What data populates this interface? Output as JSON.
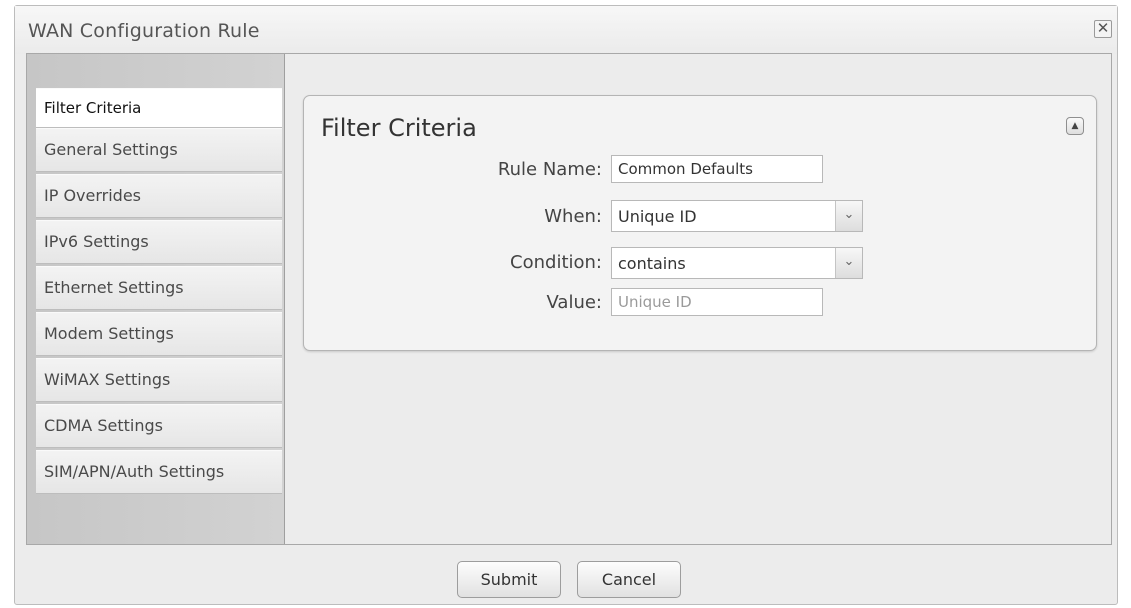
{
  "dialog": {
    "title": "WAN Configuration Rule",
    "close_icon": "close-icon",
    "close_glyph": "✕"
  },
  "sidebar": {
    "items": [
      {
        "label": "Filter Criteria",
        "active": true
      },
      {
        "label": "General Settings"
      },
      {
        "label": "IP Overrides"
      },
      {
        "label": "IPv6 Settings"
      },
      {
        "label": "Ethernet Settings"
      },
      {
        "label": "Modem Settings"
      },
      {
        "label": "WiMAX Settings"
      },
      {
        "label": "CDMA Settings"
      },
      {
        "label": "SIM/APN/Auth Settings"
      }
    ]
  },
  "panel": {
    "title": "Filter Criteria",
    "collapse_icon": "collapse-up-icon",
    "collapse_glyph": "▲",
    "fields": {
      "rule_name": {
        "label": "Rule Name:",
        "value": "Common Defaults"
      },
      "when": {
        "label": "When:",
        "value": "Unique ID"
      },
      "condition": {
        "label": "Condition:",
        "value": "contains"
      },
      "value": {
        "label": "Value:",
        "placeholder": "Unique ID"
      }
    },
    "dropdown_glyph": "⌄"
  },
  "footer": {
    "submit_label": "Submit",
    "cancel_label": "Cancel"
  }
}
